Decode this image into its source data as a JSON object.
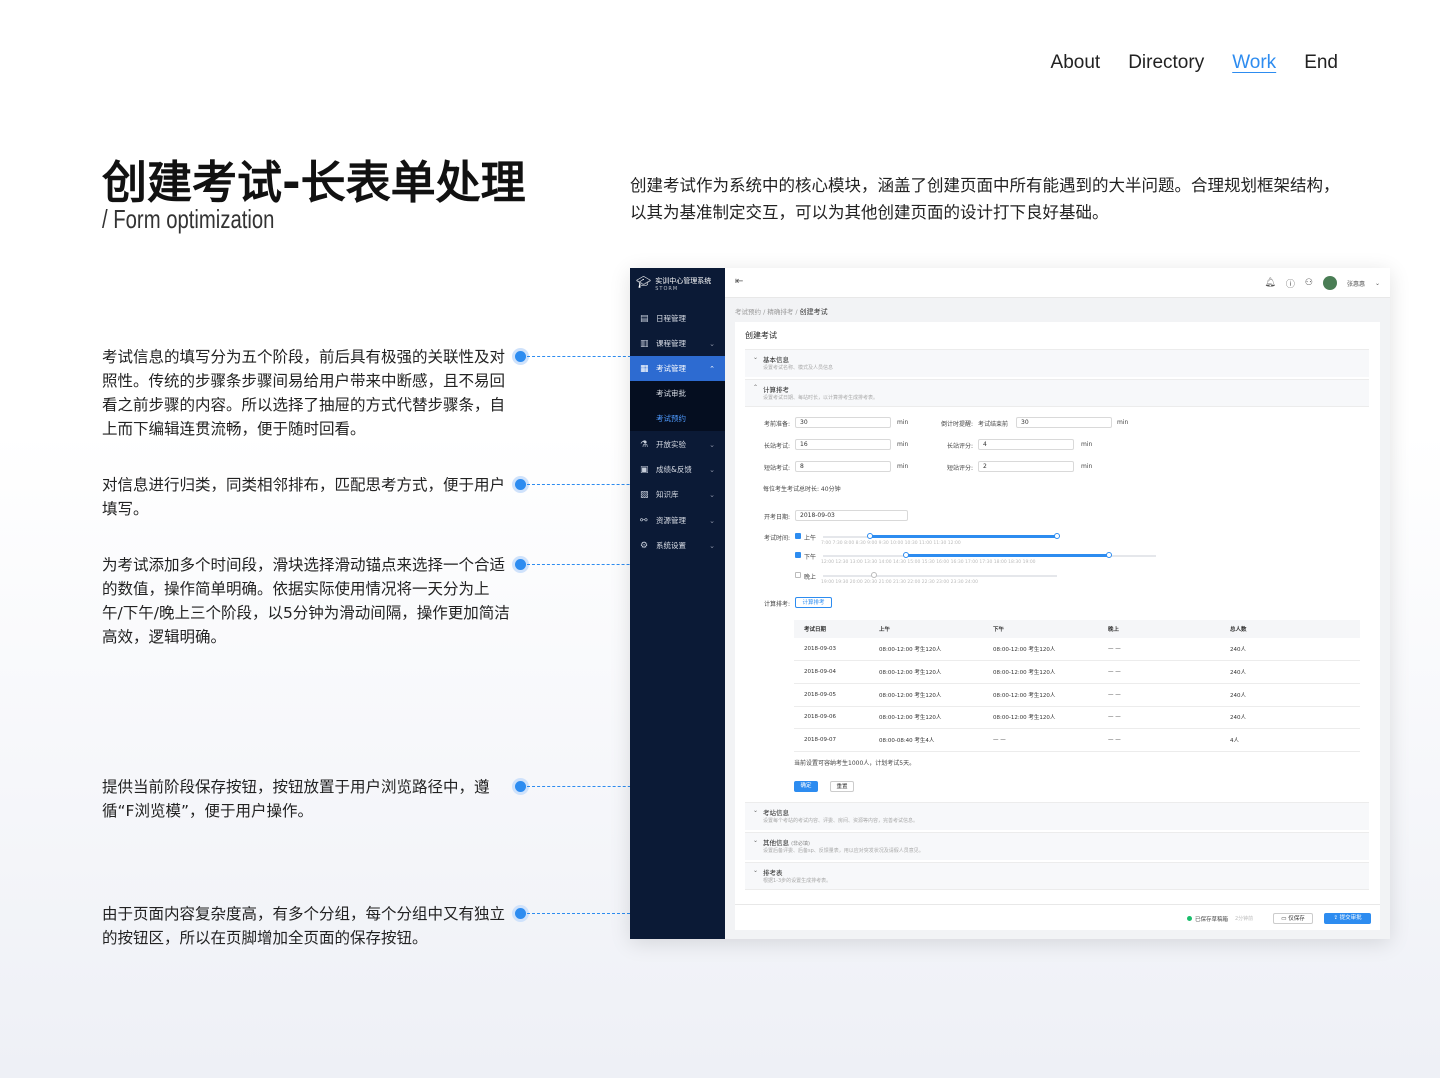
{
  "nav": {
    "about": "About",
    "directory": "Directory",
    "work": "Work",
    "end": "End"
  },
  "page": {
    "title": "创建考试-长表单处理",
    "subtitle": "/   Form optimization",
    "intro": "创建考试作为系统中的核心模块，涵盖了创建页面中所有能遇到的大半问题。合理规划框架结构，以其为基准制定交互，可以为其他创建页面的设计打下良好基础。"
  },
  "notes": [
    "考试信息的填写分为五个阶段，前后具有极强的关联性及对照性。传统的步骤条步骤间易给用户带来中断感，且不易回看之前步骤的内容。所以选择了抽屉的方式代替步骤条，自上而下编辑连贯流畅，便于随时回看。",
    "对信息进行归类，同类相邻排布，匹配思考方式，便于用户填写。",
    "为考试添加多个时间段，滑块选择滑动锚点来选择一个合适的数值，操作简单明确。依据实际使用情况将一天分为上午/下午/晚上三个阶段，以5分钟为滑动间隔，操作更加简洁高效，逻辑明确。",
    "提供当前阶段保存按钮，按钮放置于用户浏览路径中，遵循“F浏览模”，便于用户操作。",
    "由于页面内容复杂度高，有多个分组，每个分组中又有独立的按钮区，所以在页脚增加全页面的保存按钮。"
  ],
  "app": {
    "logo": "实训中心管理系统",
    "logo_sub": "STORM",
    "menu": [
      "日程管理",
      "课程管理",
      "考试管理",
      "考试审批",
      "考试预约",
      "开放实验",
      "成绩&反馈",
      "知识库",
      "资源管理",
      "系统设置"
    ],
    "user": "张惠惠",
    "breadcrumb": "考试预约 / 精确排考 / ",
    "breadcrumb_current": "创建考试",
    "card_title": "创建考试",
    "sec1_title": "基本信息",
    "sec1_desc": "设置考试名称、模式及人员信息",
    "sec2_title": "计算排考",
    "sec2_desc": "设置考试日期、每站时长，以计算排考生成排考表。",
    "labels": {
      "prep": "考前准备:",
      "countdown": "倒计时提醒:",
      "station_exam": "长站考试:",
      "station_score": "长站评分:",
      "short_exam": "短站考试:",
      "short_score": "短站评分:",
      "total": "每位考生考试总时长: 40分钟",
      "start_date": "开考日期:",
      "exam_time": "考试时间:",
      "calc": "计算排考:",
      "countdown_prefix": "考试结束前"
    },
    "values": {
      "prep": "30",
      "countdown": "30",
      "station_exam": "16",
      "station_score": "4",
      "short_exam": "8",
      "short_score": "2",
      "start_date": "2018-09-03"
    },
    "unit": "min",
    "periods": [
      "上午",
      "下午",
      "晚上"
    ],
    "ticks_am": "7:00     7:30     8:00     8:30     9:00     9:30     10:00     10:30     11:00     11:30     12:00",
    "ticks_pm": "12:00   12:30   13:00   13:30   14:00   14:30   15:00   15:30   16:00   16:30   17:00   17:30   18:00   18:30   19:00",
    "ticks_ev": "19:00   19:30   20:00   20:30   21:00   21:30   22:00   22:30   23:00   23:30   24:00",
    "slider_levels": {
      "am": [
        0.2,
        1.0
      ],
      "pm": [
        0.25,
        0.86
      ],
      "ev": [
        0.0,
        0.0
      ]
    },
    "calc_btn": "计算排考",
    "table_headers": [
      "考试日期",
      "上午",
      "下午",
      "晚上",
      "总人数"
    ],
    "table_rows": [
      [
        "2018-09-03",
        "08:00-12:00   考生120人",
        "08:00-12:00   考生120人",
        "— —",
        "240人"
      ],
      [
        "2018-09-04",
        "08:00-12:00   考生120人",
        "08:00-12:00   考生120人",
        "— —",
        "240人"
      ],
      [
        "2018-09-05",
        "08:00-12:00   考生120人",
        "08:00-12:00   考生120人",
        "— —",
        "240人"
      ],
      [
        "2018-09-06",
        "08:00-12:00   考生120人",
        "08:00-12:00   考生120人",
        "— —",
        "240人"
      ],
      [
        "2018-09-07",
        "08:00-08:40   考生4人",
        "— —",
        "— —",
        "4人"
      ]
    ],
    "summary": "当前设置可容纳考生1000人，计划考试5天。",
    "confirm": "确定",
    "reset": "重置",
    "sec3_title": "考站信息",
    "sec3_desc": "设置每个考站的考试内容、评委、房间、资源等内容，完善考试信息。",
    "sec4_title": "其他信息",
    "sec4_tag": "(非必填)",
    "sec4_desc": "设置后备评委、后备sp、反馈量表，用以应对突发状况及请假人员意见。",
    "sec5_title": "排考表",
    "sec5_desc": "根据1-3步的设置生成排考表。",
    "saved": "已保存草稿箱",
    "saved_time": "2分钟前",
    "save_only": "仅保存",
    "submit": "提交审批"
  },
  "colors": {
    "accent": "#2d8cf0",
    "sidebar": "#0b1a36"
  }
}
